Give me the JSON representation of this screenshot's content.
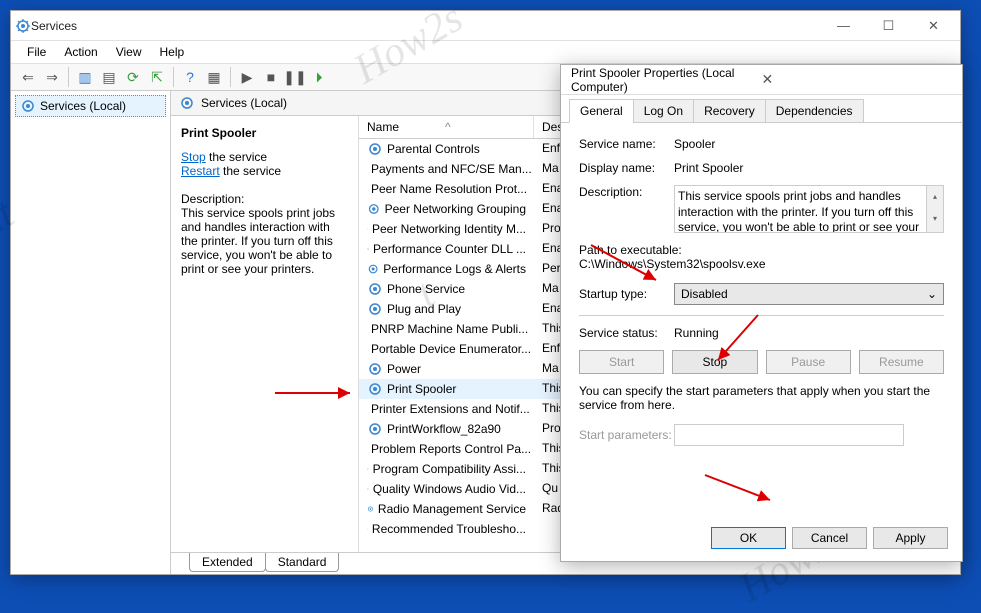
{
  "main_window": {
    "title": "Services",
    "menu": [
      "File",
      "Action",
      "View",
      "Help"
    ],
    "tree": {
      "root": "Services (Local)"
    },
    "content_title": "Services (Local)",
    "detail": {
      "service_name": "Print Spooler",
      "stop_text": "Stop",
      "restart_text": "Restart",
      "the_service": " the service",
      "desc_label": "Description:",
      "desc_text": "This service spools print jobs and handles interaction with the printer. If you turn off this service, you won't be able to print or see your printers."
    },
    "columns": {
      "name_sort_indicator": "^",
      "name": "Name",
      "desc": "Des"
    },
    "services": [
      {
        "name": "Parental Controls",
        "desc": "Enf"
      },
      {
        "name": "Payments and NFC/SE Man...",
        "desc": "Ma"
      },
      {
        "name": "Peer Name Resolution Prot...",
        "desc": "Ena"
      },
      {
        "name": "Peer Networking Grouping",
        "desc": "Ena"
      },
      {
        "name": "Peer Networking Identity M...",
        "desc": "Pro"
      },
      {
        "name": "Performance Counter DLL ...",
        "desc": "Ena"
      },
      {
        "name": "Performance Logs & Alerts",
        "desc": "Per"
      },
      {
        "name": "Phone Service",
        "desc": "Ma"
      },
      {
        "name": "Plug and Play",
        "desc": "Ena"
      },
      {
        "name": "PNRP Machine Name Publi...",
        "desc": "This"
      },
      {
        "name": "Portable Device Enumerator...",
        "desc": "Enf"
      },
      {
        "name": "Power",
        "desc": "Ma"
      },
      {
        "name": "Print Spooler",
        "desc": "This",
        "selected": true
      },
      {
        "name": "Printer Extensions and Notif...",
        "desc": "This"
      },
      {
        "name": "PrintWorkflow_82a90",
        "desc": "Pro"
      },
      {
        "name": "Problem Reports Control Pa...",
        "desc": "This"
      },
      {
        "name": "Program Compatibility Assi...",
        "desc": "This"
      },
      {
        "name": "Quality Windows Audio Vid...",
        "desc": "Qu"
      },
      {
        "name": "Radio Management Service",
        "desc": "Rad"
      },
      {
        "name": "Recommended Troublesho...",
        "desc": ""
      }
    ],
    "bottom_tabs": [
      "Extended",
      "Standard"
    ]
  },
  "dialog": {
    "title": "Print Spooler Properties (Local Computer)",
    "tabs": [
      "General",
      "Log On",
      "Recovery",
      "Dependencies"
    ],
    "labels": {
      "service_name": "Service name:",
      "display_name": "Display name:",
      "description": "Description:",
      "path": "Path to executable:",
      "startup_type": "Startup type:",
      "status": "Service status:",
      "hint": "You can specify the start parameters that apply when you start the service from here.",
      "start_params": "Start parameters:"
    },
    "values": {
      "service_name": "Spooler",
      "display_name": "Print Spooler",
      "description": "This service spools print jobs and handles interaction with the printer.  If you turn off this service, you won't be able to print or see your printers.",
      "path": "C:\\Windows\\System32\\spoolsv.exe",
      "startup_type": "Disabled",
      "status": "Running"
    },
    "buttons": {
      "start": "Start",
      "stop": "Stop",
      "pause": "Pause",
      "resume": "Resume",
      "ok": "OK",
      "cancel": "Cancel",
      "apply": "Apply"
    }
  }
}
